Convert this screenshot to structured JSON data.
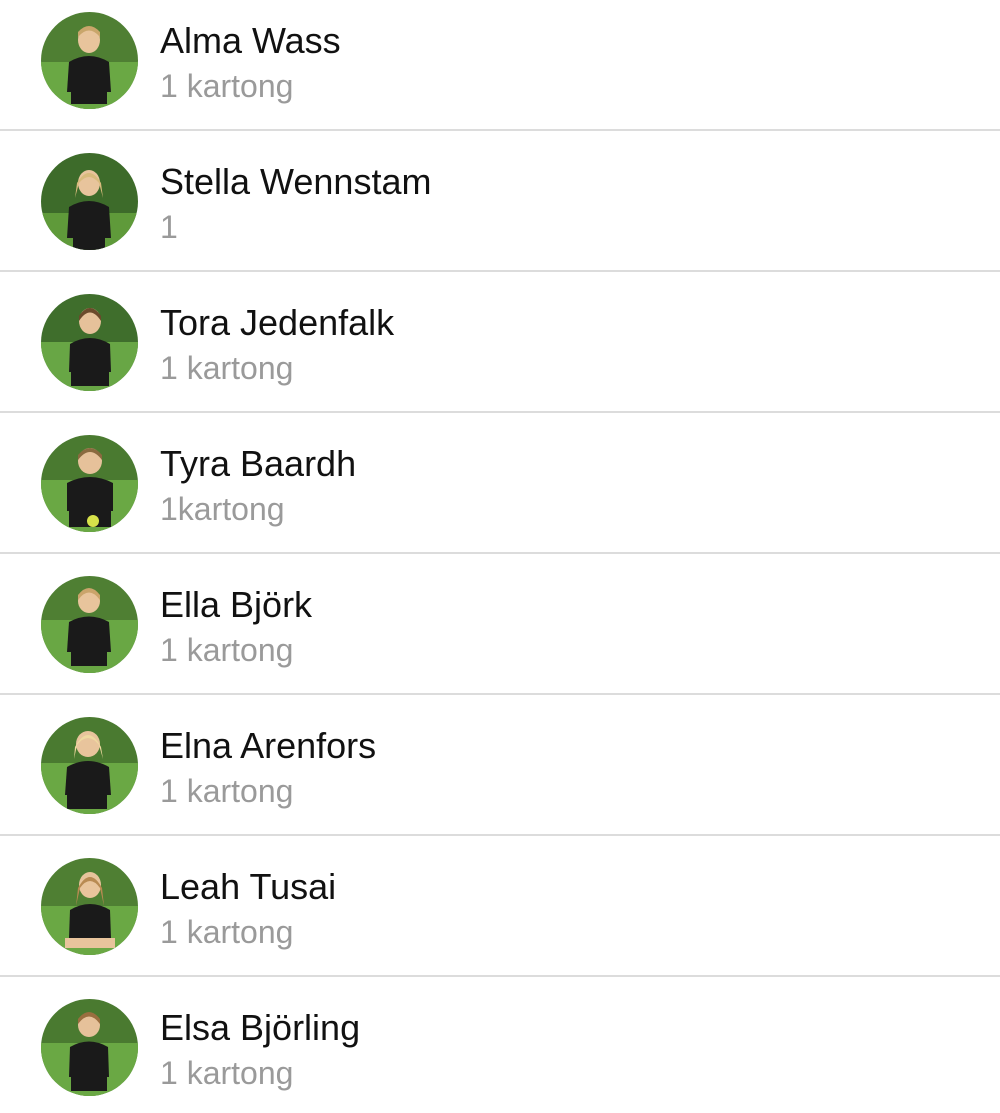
{
  "colors": {
    "background": "#ffffff",
    "name_text": "#111111",
    "sub_text": "#9a9a9a",
    "divider": "#dcdcdc",
    "grass": "#5f9a3a",
    "trees": "#3d6b2a",
    "jersey": "#1a1a1a"
  },
  "people": [
    {
      "name": "Alma Wass",
      "sub": "1 kartong",
      "icon": "player-photo"
    },
    {
      "name": "Stella Wennstam",
      "sub": "1",
      "icon": "player-photo"
    },
    {
      "name": "Tora Jedenfalk",
      "sub": "1 kartong",
      "icon": "player-photo"
    },
    {
      "name": "Tyra Baardh",
      "sub": "1kartong",
      "icon": "player-photo"
    },
    {
      "name": "Ella Björk",
      "sub": "1 kartong",
      "icon": "player-photo"
    },
    {
      "name": "Elna Arenfors",
      "sub": "1 kartong",
      "icon": "player-photo"
    },
    {
      "name": "Leah Tusai",
      "sub": "1 kartong",
      "icon": "player-photo"
    },
    {
      "name": "Elsa Björling",
      "sub": "1 kartong",
      "icon": "player-photo"
    }
  ]
}
